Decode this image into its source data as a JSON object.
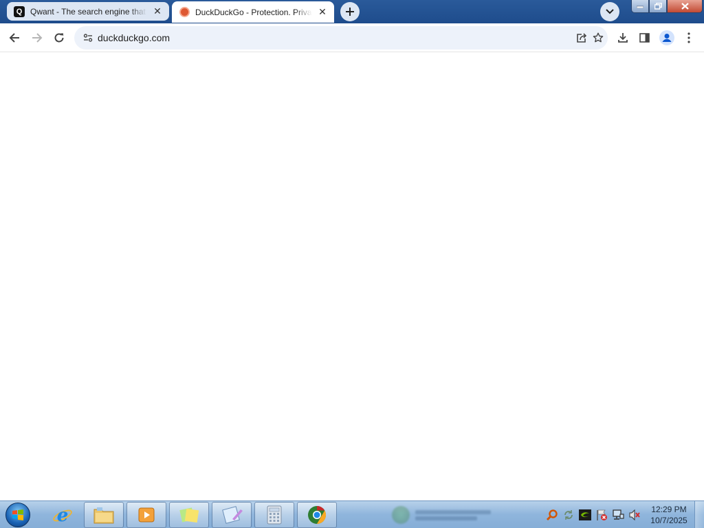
{
  "browser": {
    "tabs": [
      {
        "title": "Qwant - The search engine that",
        "favicon": "qwant-logo-icon",
        "active": false
      },
      {
        "title": "DuckDuckGo - Protection. Privacy",
        "favicon": "duckduckgo-logo-icon",
        "active": true
      }
    ],
    "new_tab_icon": "plus-icon",
    "tab_search_icon": "chevron-down-icon",
    "window_controls": [
      "minimize",
      "maximize",
      "close"
    ],
    "toolbar": {
      "back_icon": "arrow-left-icon",
      "forward_icon": "arrow-right-icon",
      "reload_icon": "reload-icon",
      "url": "duckduckgo.com",
      "omnibox_icons": [
        "share-icon",
        "bookmark-star-icon"
      ],
      "right_icons": [
        "download-icon",
        "side-panel-icon",
        "profile-icon",
        "menu-dots-icon"
      ]
    }
  },
  "page": {
    "content": ""
  },
  "taskbar": {
    "start_icon": "windows-start-orb-icon",
    "apps": [
      {
        "name": "internet-explorer",
        "running": false
      },
      {
        "name": "file-explorer",
        "running": true
      },
      {
        "name": "media-player",
        "running": true
      },
      {
        "name": "sticky-notes",
        "running": true
      },
      {
        "name": "notepad",
        "running": true
      },
      {
        "name": "calculator",
        "running": true
      },
      {
        "name": "chrome-browser",
        "running": true
      }
    ],
    "tray_icons": [
      "search-magnifier-icon",
      "network-sync-icon",
      "nvidia-icon",
      "action-center-flag-icon",
      "network-icon",
      "volume-muted-icon"
    ],
    "clock": {
      "time": "12:29 PM",
      "date": "10/7/2025"
    },
    "colors": {
      "taskbar_bg": "#8fb5dc",
      "titlebar_bg": "#1e4c8c",
      "tab_active_bg": "#ffffff",
      "tab_inactive_bg": "#dde6f3",
      "omnibox_bg": "#edf2fa"
    }
  }
}
